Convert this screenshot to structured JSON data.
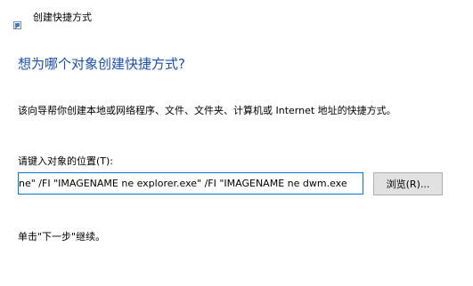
{
  "window": {
    "title": "创建快捷方式",
    "icon": "shortcut-wizard-icon"
  },
  "main": {
    "heading": "想为哪个对象创建快捷方式?",
    "description": "该向导帮你创建本地或网络程序、文件、文件夹、计算机或 Internet 地址的快捷方式。",
    "location_label": "请键入对象的位置(T):",
    "location_value": "ne\" /FI \"IMAGENAME ne explorer.exe\" /FI \"IMAGENAME ne dwm.exe",
    "browse_label": "浏览(R)...",
    "hint": "单击\"下一步\"继续。"
  },
  "colors": {
    "heading": "#1a4fb2",
    "input_border_focus": "#0078d7",
    "button_background": "#e1e1e1"
  }
}
